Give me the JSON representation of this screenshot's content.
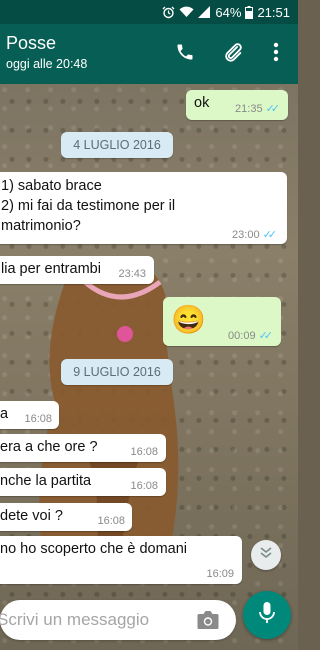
{
  "status_bar": {
    "battery": "64%",
    "time": "21:51"
  },
  "header": {
    "title": "Posse",
    "subtitle": "oggi alle 20:48"
  },
  "messages": [
    {
      "text": "ok",
      "time": "21:35"
    },
    {
      "date": "4 LUGLIO 2016"
    },
    {
      "lines": [
        "1) sabato brace",
        "2) mi fai da testimone per il",
        "matrimonio?"
      ],
      "time": "23:00"
    },
    {
      "text": "lia per entrambi",
      "time": "23:43"
    },
    {
      "text": "😄",
      "time": "00:09"
    },
    {
      "date": "9 LUGLIO 2016"
    },
    {
      "text": "a",
      "time": "16:08"
    },
    {
      "text": "era a che ore ?",
      "time": "16:08"
    },
    {
      "text": "nche la partita",
      "time": "16:08"
    },
    {
      "text": "dete voi ?",
      "time": "16:08"
    },
    {
      "text": "no ho scoperto che è domani",
      "time": "16:09"
    }
  ],
  "input": {
    "placeholder": "Scrivi un messaggio"
  },
  "colors": {
    "header": "#075e54",
    "statusbar": "#054d44",
    "outgoing": "#dcf8c6",
    "accent": "#00897b",
    "read_ticks": "#4fc3f7"
  },
  "icons": [
    "alarm-icon",
    "wifi-icon",
    "signal-icon",
    "battery-icon",
    "phone-icon",
    "attach-icon",
    "more-icon",
    "double-check-icon",
    "camera-icon",
    "mic-icon",
    "chevron-down-icon"
  ]
}
